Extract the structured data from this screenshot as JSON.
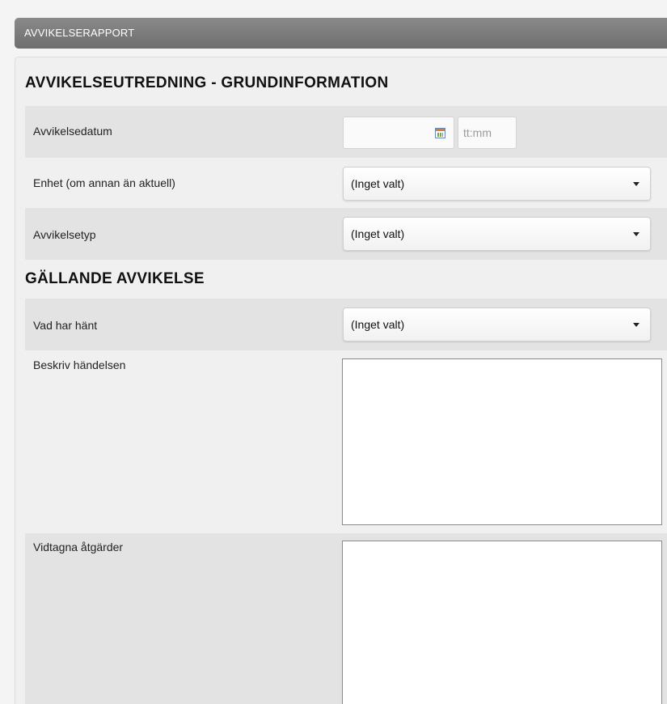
{
  "header": {
    "title": "AVVIKELSERAPPORT"
  },
  "sections": {
    "basic": {
      "title": "AVVIKELSEUTREDNING - GRUNDINFORMATION"
    },
    "current": {
      "title": "GÄLLANDE AVVIKELSE"
    }
  },
  "fields": {
    "date": {
      "label": "Avvikelsedatum",
      "date_value": "",
      "time_placeholder": "tt:mm"
    },
    "unit": {
      "label": "Enhet (om annan än aktuell)",
      "value": "(Inget valt)"
    },
    "type": {
      "label": "Avvikelsetyp",
      "value": "(Inget valt)"
    },
    "what_happened": {
      "label": "Vad har hänt",
      "value": "(Inget valt)"
    },
    "description": {
      "label": "Beskriv händelsen",
      "value": ""
    },
    "actions": {
      "label": "Vidtagna åtgärder",
      "value": ""
    }
  },
  "icons": {
    "calendar": "calendar-icon",
    "dropdown": "chevron-down-icon"
  }
}
